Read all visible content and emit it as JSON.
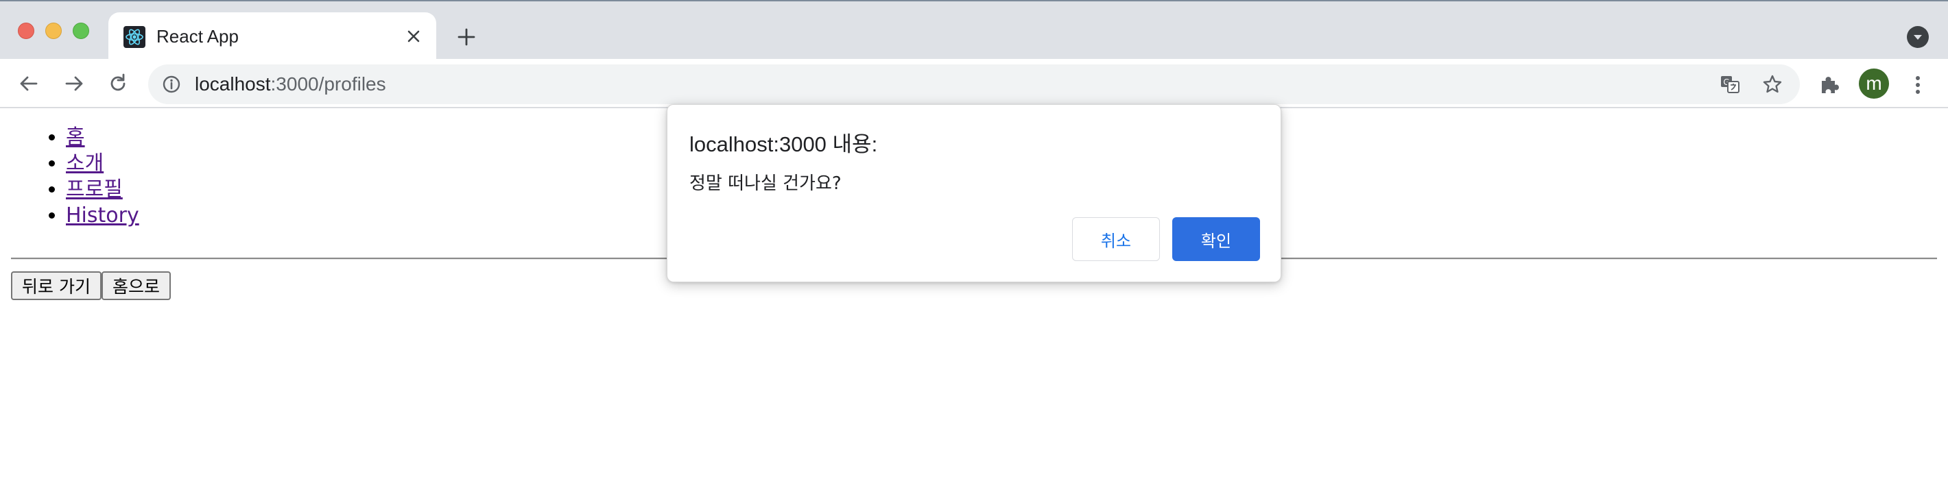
{
  "browser": {
    "tab_title": "React App",
    "url_host": "localhost",
    "url_rest": ":3000/profiles",
    "avatar_letter": "m"
  },
  "page": {
    "nav_links": [
      "홈",
      "소개",
      "프로필",
      "History"
    ],
    "buttons": {
      "back": "뒤로 가기",
      "home": "홈으로"
    }
  },
  "dialog": {
    "title": "localhost:3000 내용:",
    "message": "정말 떠나실 건가요?",
    "cancel_label": "취소",
    "ok_label": "확인",
    "ok_color": "#2d6fe0"
  },
  "icons": {
    "window_controls": [
      "close-window-icon",
      "minimize-window-icon",
      "zoom-window-icon"
    ],
    "tab": [
      "react-logo-icon",
      "close-icon",
      "plus-icon",
      "chevron-down-icon"
    ],
    "toolbar": [
      "back-arrow-icon",
      "forward-arrow-icon",
      "reload-icon",
      "info-icon",
      "translate-icon",
      "star-icon",
      "puzzle-icon",
      "kebab-menu-icon"
    ]
  }
}
